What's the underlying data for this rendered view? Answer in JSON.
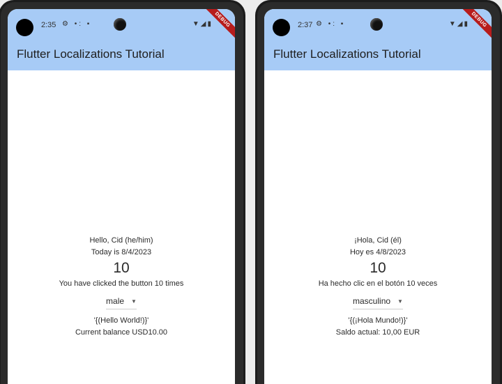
{
  "screens": [
    {
      "status": {
        "time": "2:35",
        "left_icons": "⚙ •: ▪",
        "right_icons": "▼◢▮",
        "debug": "DEBUG"
      },
      "app_title": "Flutter Localizations Tutorial",
      "greeting": "Hello, Cid (he/him)",
      "date_line": "Today is 8/4/2023",
      "counter": "10",
      "clicked_line": "You have clicked the button 10 times",
      "dropdown_value": "male",
      "hello_line": "'{(Hello World!)}'",
      "balance_line": "Current balance USD10.00"
    },
    {
      "status": {
        "time": "2:37",
        "left_icons": "⚙ •: ▪",
        "right_icons": "▼◢▮",
        "debug": "DEBUG"
      },
      "app_title": "Flutter Localizations Tutorial",
      "greeting": "¡Hola, Cid (él)",
      "date_line": "Hoy es 4/8/2023",
      "counter": "10",
      "clicked_line": "Ha hecho clic en el botón 10 veces",
      "dropdown_value": "masculino",
      "hello_line": "'{(¡Hola Mundo!)}'",
      "balance_line": "Saldo actual: 10,00 EUR"
    }
  ],
  "colors": {
    "app_bar": "#a7cbf6",
    "debug_ribbon": "#b71c1c"
  },
  "icons": {
    "dropdown": "triangle-down-icon",
    "wifi": "wifi-icon",
    "signal": "signal-icon",
    "battery": "battery-icon"
  }
}
